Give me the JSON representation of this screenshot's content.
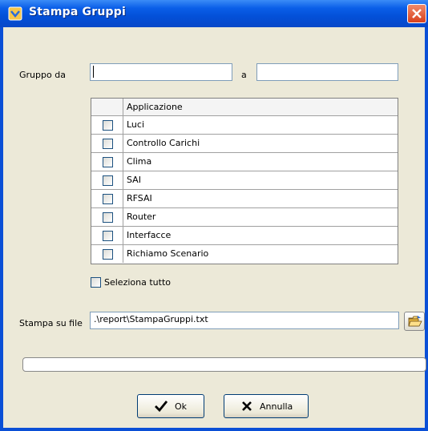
{
  "window": {
    "title": "Stampa Gruppi"
  },
  "filters": {
    "from_label": "Gruppo da",
    "to_label": "a",
    "from_value": "",
    "to_value": ""
  },
  "table": {
    "header": "Applicazione",
    "rows": [
      {
        "label": "Luci",
        "checked": false
      },
      {
        "label": "Controllo Carichi",
        "checked": false
      },
      {
        "label": "Clima",
        "checked": false
      },
      {
        "label": "SAI",
        "checked": false
      },
      {
        "label": "RFSAI",
        "checked": false
      },
      {
        "label": "Router",
        "checked": false
      },
      {
        "label": "Interfacce",
        "checked": false
      },
      {
        "label": "Richiamo Scenario",
        "checked": false
      }
    ]
  },
  "select_all": {
    "label": "Seleziona tutto",
    "checked": false
  },
  "output": {
    "label": "Stampa su file",
    "value": ".\\report\\StampaGruppi.txt"
  },
  "progress": {
    "value": 0
  },
  "buttons": {
    "ok": "Ok",
    "cancel": "Annulla"
  },
  "icons": {
    "title": "app-icon",
    "close": "close-icon",
    "folder": "open-folder-icon",
    "ok": "checkmark-icon",
    "cancel": "x-icon"
  }
}
